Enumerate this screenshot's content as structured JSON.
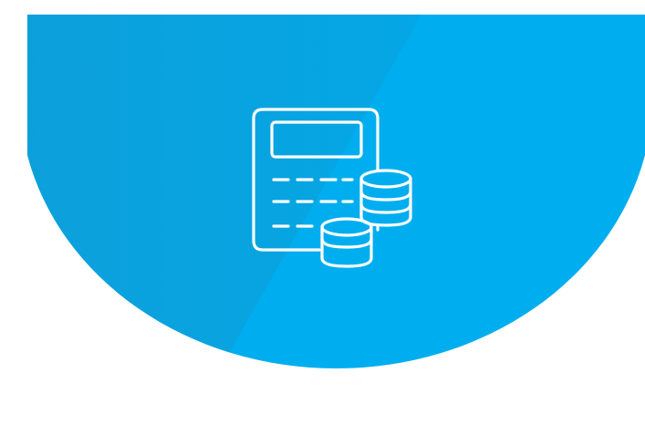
{
  "background_color": "#ffffff",
  "badge": {
    "shape": "half-circle",
    "color": "#00aeef",
    "highlight_color": "#0a9fdc"
  },
  "icon": {
    "name": "calculator-coins-icon",
    "stroke_color": "#ffffff"
  }
}
